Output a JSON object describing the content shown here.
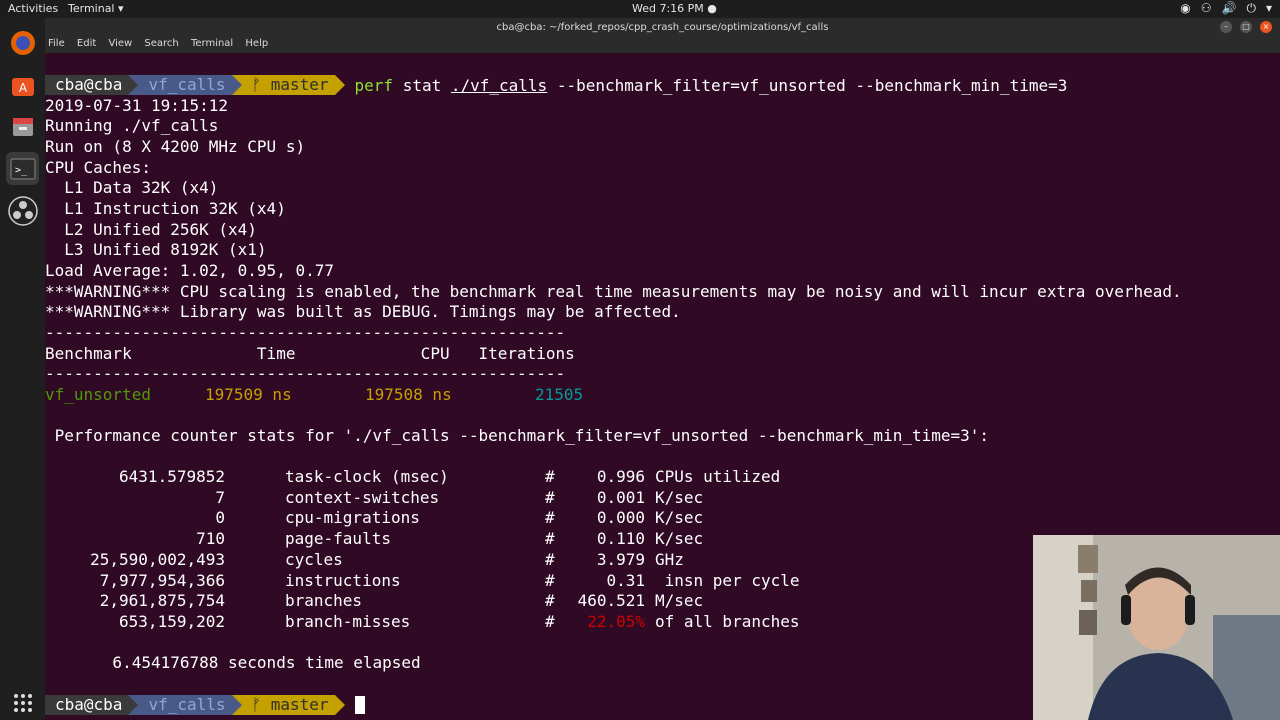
{
  "topbar": {
    "activities": "Activities",
    "app": "Terminal ▾",
    "clock": "Wed  7:16 PM ●"
  },
  "window": {
    "title": "cba@cba: ~/forked_repos/cpp_crash_course/optimizations/vf_calls",
    "menu": [
      "File",
      "Edit",
      "View",
      "Search",
      "Terminal",
      "Help"
    ]
  },
  "prompt": {
    "user": "cba@cba",
    "dir": "vf_calls",
    "branch": "master"
  },
  "command": {
    "perf": "perf",
    "stat": " stat ",
    "exe": "./vf_calls",
    "args": " --benchmark_filter=vf_unsorted --benchmark_min_time=3"
  },
  "output": {
    "date": "2019-07-31 19:15:12",
    "running": "Running ./vf_calls",
    "run_on": "Run on (8 X 4200 MHz CPU s)",
    "cpu_caches": "CPU Caches:",
    "l1d": "  L1 Data 32K (x4)",
    "l1i": "  L1 Instruction 32K (x4)",
    "l2": "  L2 Unified 256K (x4)",
    "l3": "  L3 Unified 8192K (x1)",
    "load": "Load Average: 1.02, 0.95, 0.77",
    "warn1": "***WARNING*** CPU scaling is enabled, the benchmark real time measurements may be noisy and will incur extra overhead.",
    "warn2": "***WARNING*** Library was built as DEBUG. Timings may be affected.",
    "dashes": "------------------------------------------------------",
    "header": "Benchmark             Time             CPU   Iterations",
    "result": {
      "name": "vf_unsorted",
      "time": "197509 ns",
      "cpu": "197508 ns",
      "iters": "21505"
    },
    "perf_header": " Performance counter stats for './vf_calls --benchmark_filter=vf_unsorted --benchmark_min_time=3':",
    "stats": [
      {
        "value": "6431.579852",
        "event": "task-clock (msec)",
        "hash": "#",
        "rate": "0.996",
        "unit": "CPUs utilized",
        "red": false
      },
      {
        "value": "7",
        "event": "context-switches",
        "hash": "#",
        "rate": "0.001",
        "unit": "K/sec",
        "red": false
      },
      {
        "value": "0",
        "event": "cpu-migrations",
        "hash": "#",
        "rate": "0.000",
        "unit": "K/sec",
        "red": false
      },
      {
        "value": "710",
        "event": "page-faults",
        "hash": "#",
        "rate": "0.110",
        "unit": "K/sec",
        "red": false
      },
      {
        "value": "25,590,002,493",
        "event": "cycles",
        "hash": "#",
        "rate": "3.979",
        "unit": "GHz",
        "red": false
      },
      {
        "value": "7,977,954,366",
        "event": "instructions",
        "hash": "#",
        "rate": "0.31",
        "unit": " insn per cycle",
        "red": false
      },
      {
        "value": "2,961,875,754",
        "event": "branches",
        "hash": "#",
        "rate": "460.521",
        "unit": "M/sec",
        "red": false
      },
      {
        "value": "653,159,202",
        "event": "branch-misses",
        "hash": "#",
        "rate": "22.05%",
        "unit": "of all branches",
        "red": true
      }
    ],
    "elapsed": "       6.454176788 seconds time elapsed"
  }
}
